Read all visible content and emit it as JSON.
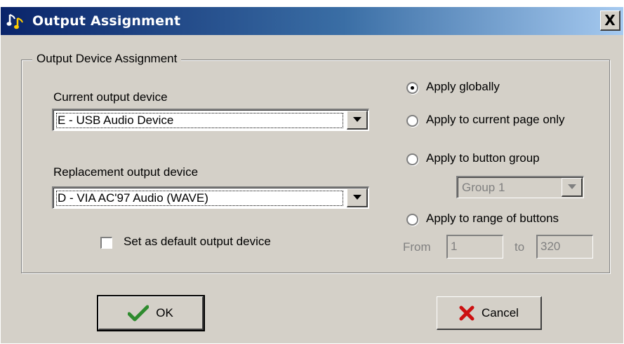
{
  "window": {
    "title": "Output Assignment",
    "close_label": "X"
  },
  "group": {
    "label": "Output Device Assignment"
  },
  "current_device": {
    "label": "Current output device",
    "value": "E - USB Audio Device"
  },
  "replacement_device": {
    "label": "Replacement output device",
    "value": "D - VIA AC'97 Audio (WAVE)"
  },
  "default_checkbox": {
    "label": "Set as default output device",
    "checked": false
  },
  "scope": {
    "options": [
      {
        "label": "Apply globally",
        "selected": true
      },
      {
        "label": "Apply to current page only",
        "selected": false
      },
      {
        "label": "Apply to button group",
        "selected": false
      },
      {
        "label": "Apply to range of buttons",
        "selected": false
      }
    ],
    "group_select": "Group 1",
    "range": {
      "from_label": "From",
      "from_value": "1",
      "to_label": "to",
      "to_value": "320"
    }
  },
  "buttons": {
    "ok": "OK",
    "cancel": "Cancel"
  },
  "colors": {
    "title_start": "#0a246a",
    "title_end": "#a6caf0",
    "face": "#d4d0c8",
    "ok_check": "#2e8b2e",
    "cancel_x": "#cc1010"
  }
}
